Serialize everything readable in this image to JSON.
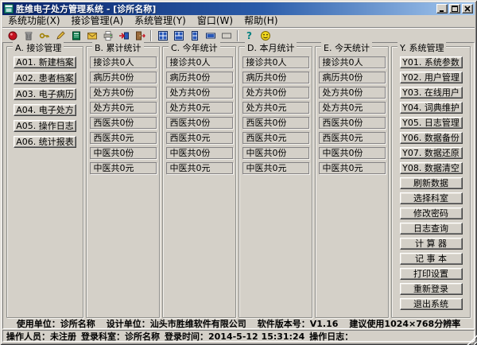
{
  "window": {
    "title": "胜维电子处方管理系统 - [诊所名称]"
  },
  "menu": {
    "items": [
      "系统功能(X)",
      "接诊管理(A)",
      "系统管理(Y)",
      "窗口(W)",
      "帮助(H)"
    ]
  },
  "toolbar": {
    "help_glyph": "?",
    "icon_names": [
      "new-record-icon",
      "archive-icon",
      "key-icon",
      "edit-icon",
      "medical-record-icon",
      "prescription-icon",
      "print-icon",
      "export-data-icon",
      "exit-icon",
      "tile-windows-icon",
      "cascade-windows-icon",
      "tile-vertical-icon",
      "tile-horizontal-icon",
      "minimize-all-icon",
      "help-icon",
      "smiley-icon"
    ]
  },
  "reception_group": {
    "title": "A. 接诊管理",
    "buttons": [
      "A01. 新建档案",
      "A02. 患者档案",
      "A03. 电子病历",
      "A04. 电子处方",
      "A05. 操作日志",
      "A06. 统计报表"
    ]
  },
  "stats_groups": [
    {
      "title": "B. 累计统计",
      "fields": [
        "接诊共0人",
        "病历共0份",
        "处方共0份",
        "处方共0元",
        "西医共0份",
        "西医共0元",
        "中医共0份",
        "中医共0元"
      ]
    },
    {
      "title": "C. 今年统计",
      "fields": [
        "接诊共0人",
        "病历共0份",
        "处方共0份",
        "处方共0元",
        "西医共0份",
        "西医共0元",
        "中医共0份",
        "中医共0元"
      ]
    },
    {
      "title": "D. 本月统计",
      "fields": [
        "接诊共0人",
        "病历共0份",
        "处方共0份",
        "处方共0元",
        "西医共0份",
        "西医共0元",
        "中医共0份",
        "中医共0元"
      ]
    },
    {
      "title": "E. 今天统计",
      "fields": [
        "接诊共0人",
        "病历共0份",
        "处方共0份",
        "处方共0元",
        "西医共0份",
        "西医共0元",
        "中医共0份",
        "中医共0元"
      ]
    }
  ],
  "system_group": {
    "title": "Y. 系统管理",
    "buttons": [
      "Y01. 系统参数",
      "Y02. 用户管理",
      "Y03. 在线用户",
      "Y04. 词典维护",
      "Y05. 日志管理",
      "Y06. 数据备份",
      "Y07. 数据还原",
      "Y08. 数据清空",
      "刷新数据",
      "选择科室",
      "修改密码",
      "日志查询",
      "计 算 器",
      "记 事 本",
      "打印设置",
      "重新登录",
      "退出系统"
    ]
  },
  "footer": {
    "segments": [
      "使用单位：诊所名称",
      "设计单位：汕头市胜维软件有限公司",
      "软件版本号：V1.16",
      "建议使用1024×768分辨率"
    ]
  },
  "statusbar": {
    "segments": [
      "操作人员：未注册",
      "登录科室：诊所名称",
      "登录时间：2014-5-12 15:31:24",
      "操作日志："
    ]
  },
  "colors": {
    "window_bg": "#d4d0c8",
    "titlebar_start": "#0a246a",
    "titlebar_end": "#a6caf0",
    "title_text": "#ffffff"
  }
}
